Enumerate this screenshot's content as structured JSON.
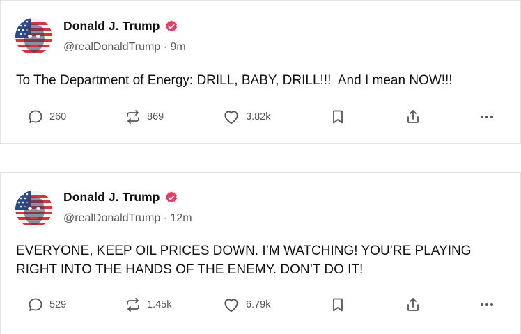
{
  "posts": [
    {
      "author_name": "Donald J. Trump",
      "handle": "@realDonaldTrump",
      "separator": "·",
      "time": "9m",
      "text": "To The Department of Energy: DRILL, BABY, DRILL!!!  And I mean NOW!!!",
      "replies": "260",
      "reposts": "869",
      "likes": "3.82k"
    },
    {
      "author_name": "Donald J. Trump",
      "handle": "@realDonaldTrump",
      "separator": "·",
      "time": "12m",
      "text": "EVERYONE, KEEP OIL PRICES DOWN. I’M WATCHING! YOU’RE PLAYING RIGHT INTO THE HANDS OF THE ENEMY. DON’T DO IT!",
      "replies": "529",
      "reposts": "1.45k",
      "likes": "6.79k"
    }
  ],
  "colors": {
    "verified_badge": "#ec3a67",
    "action_icon": "#555555",
    "handle_text": "#585858",
    "divider": "#e4e4e4"
  },
  "icons": [
    "verified-badge-icon",
    "reply-icon",
    "repost-icon",
    "like-icon",
    "bookmark-icon",
    "share-icon",
    "more-icon"
  ]
}
